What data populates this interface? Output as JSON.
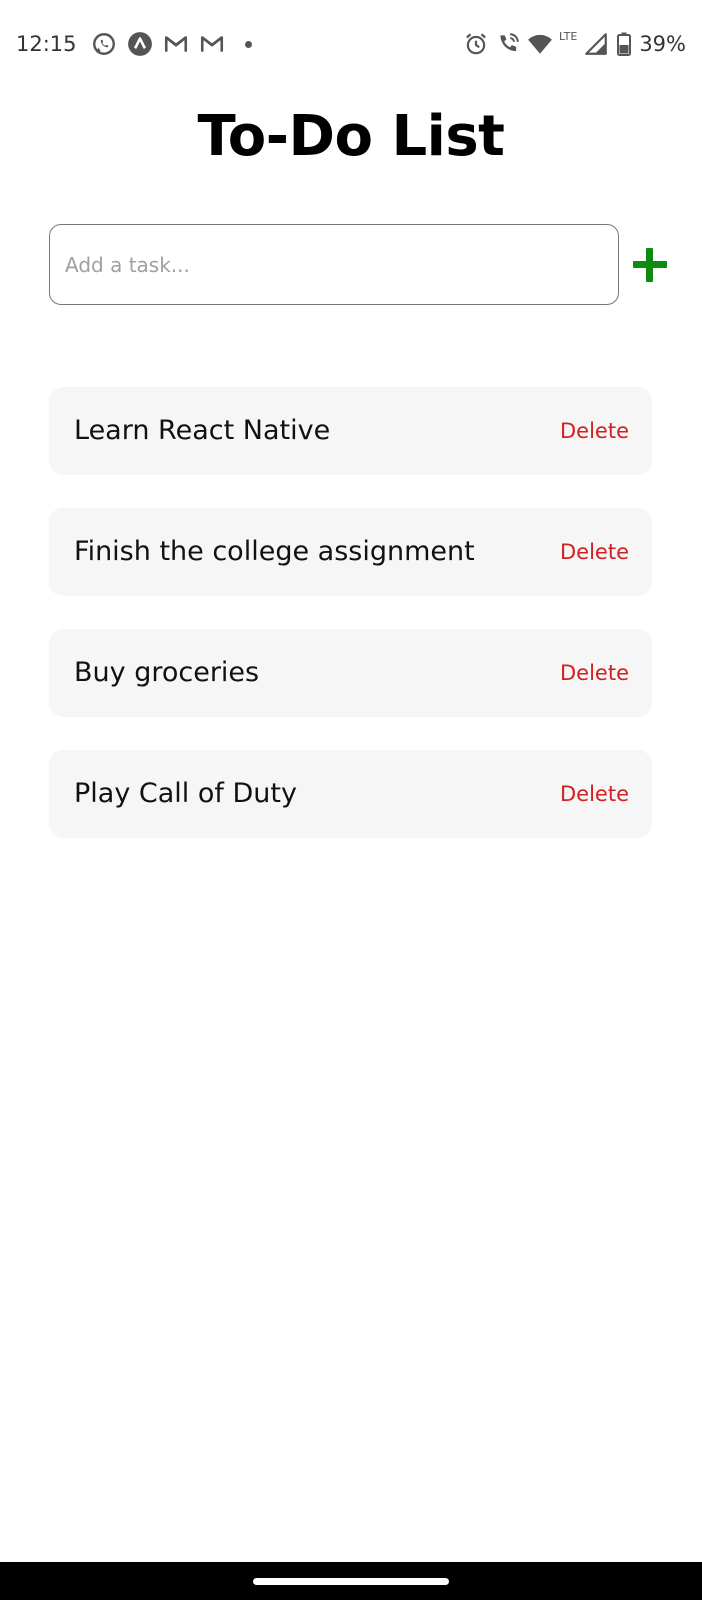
{
  "status_bar": {
    "time": "12:15",
    "left_icons": [
      "whatsapp-icon",
      "app-a-icon",
      "gmail-icon",
      "gmail-icon"
    ],
    "right_icons": [
      "alarm-icon",
      "wifi-calling-icon",
      "wifi-icon",
      "signal-icon",
      "battery-icon"
    ],
    "network": "LTE",
    "battery": "39%"
  },
  "header": {
    "title": "To-Do List"
  },
  "input": {
    "placeholder": "Add a task...",
    "value": "",
    "add_icon": "plus-icon",
    "add_color": "#0e8a0e"
  },
  "tasks": [
    {
      "text": "Learn React Native",
      "delete_label": "Delete"
    },
    {
      "text": "Finish the college assignment",
      "delete_label": "Delete"
    },
    {
      "text": "Buy groceries",
      "delete_label": "Delete"
    },
    {
      "text": "Play Call of Duty",
      "delete_label": "Delete"
    }
  ],
  "colors": {
    "delete": "#d32020",
    "item_bg": "#f6f6f6"
  }
}
